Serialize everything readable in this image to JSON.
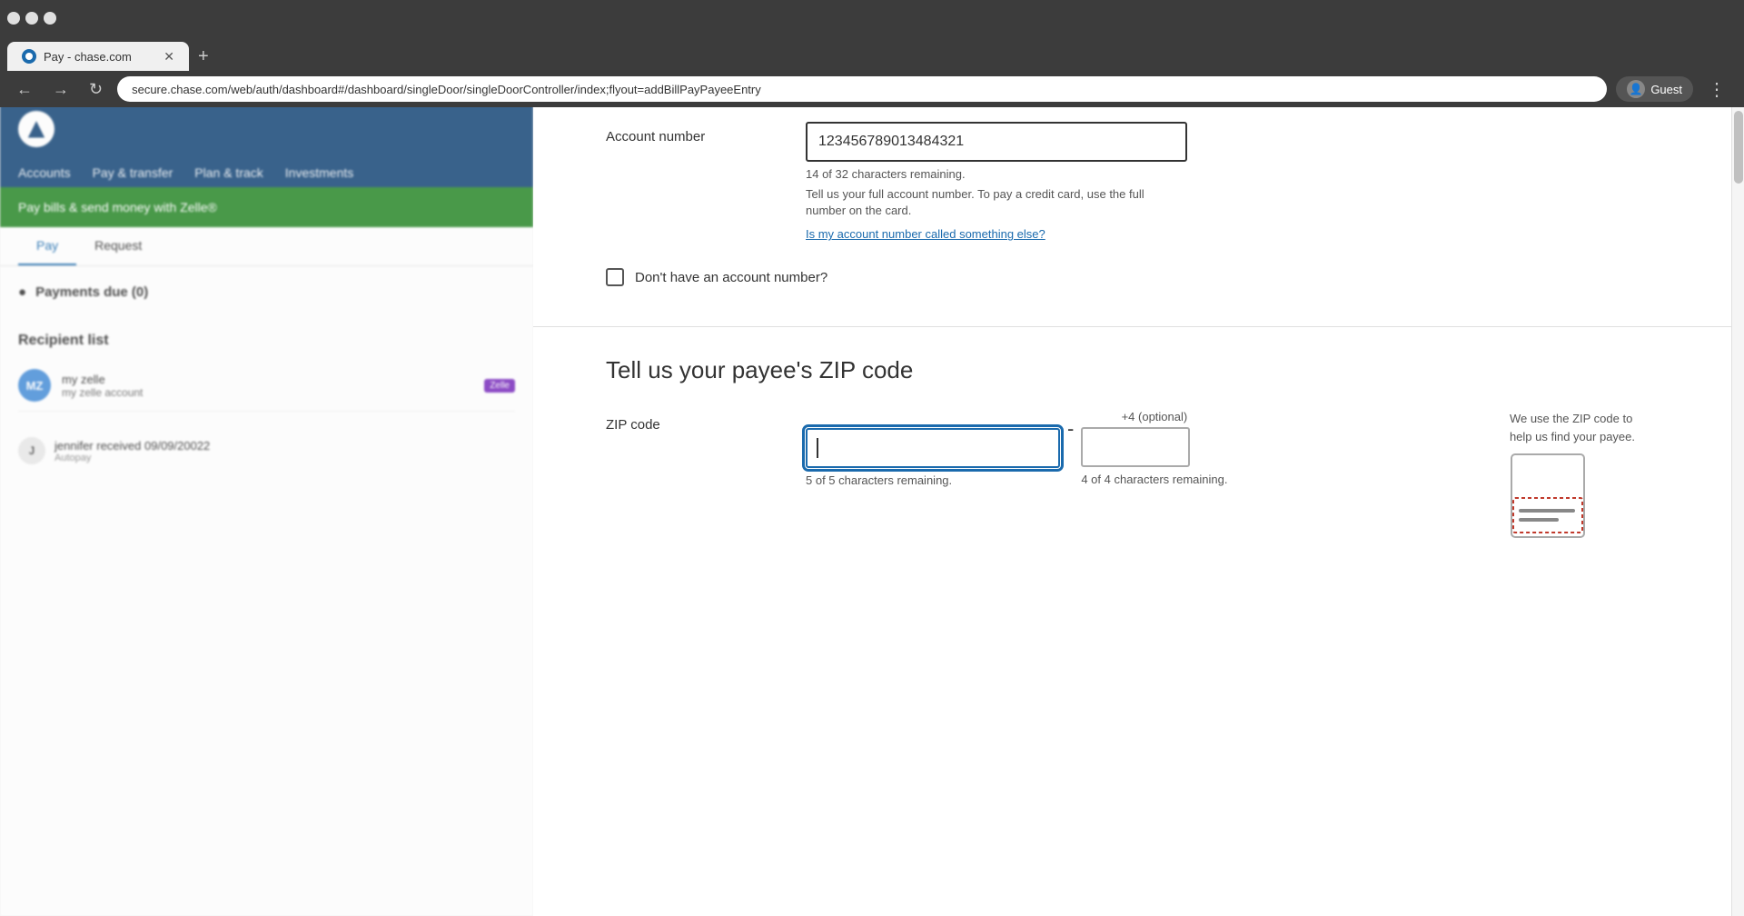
{
  "browser": {
    "tab_title": "Pay - chase.com",
    "address": "secure.chase.com/web/auth/dashboard#/dashboard/singleDoor/singleDoorController/index;flyout=addBillPayPayeeEntry",
    "user_label": "Guest"
  },
  "left_panel": {
    "nav_items": [
      "Accounts",
      "Pay & transfer",
      "Plan & track",
      "Investments"
    ],
    "pay_transfer_sub": "",
    "banner_text": "Pay bills & send money with Zelle®",
    "pay_tab": "Pay",
    "request_tab": "Request",
    "payments_due": "Payments due (0)",
    "recipient_list_title": "Recipient list",
    "recipient": {
      "name": "my zelle",
      "amount": "my zelle account",
      "tag": "Zelle"
    },
    "recent_label": "jennifer received 09/09/20022",
    "recent_sub": "Autopay"
  },
  "form": {
    "account_number_label": "Account number",
    "account_number_value": "123456789013484321",
    "chars_remaining": "14 of 32 characters remaining.",
    "hint_text": "Tell us your full account number. To pay a credit card, use the full number on the card.",
    "link_text": "Is my account number called something else?",
    "checkbox_label": "Don't have an account number?",
    "zip_section_heading": "Tell us your payee's ZIP code",
    "zip_label": "ZIP code",
    "zip_value": "",
    "zip_chars_remaining": "5 of 5 characters remaining.",
    "zip4_optional": "+4 (optional)",
    "zip4_chars_remaining": "4 of 4 characters remaining.",
    "zip4_value": "",
    "zip_hint_text": "We use the ZIP code to\nhelp us find your payee."
  }
}
